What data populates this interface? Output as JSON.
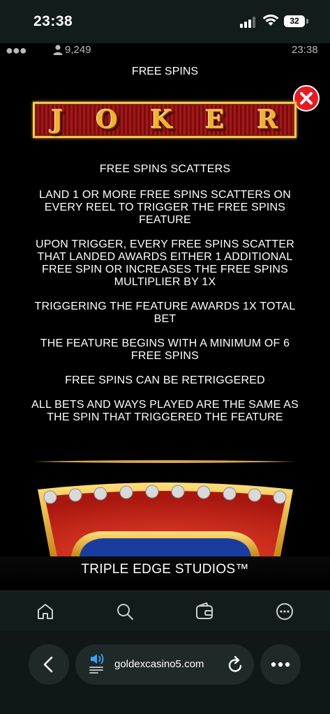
{
  "status_bar": {
    "time": "23:38",
    "battery": "32"
  },
  "game_bar": {
    "player_count": "9,249",
    "time": "23:38"
  },
  "screen": {
    "title": "FREE SPINS",
    "logo_text": "JOKER",
    "subtitle": "FREE SPINS SCATTERS",
    "rules": [
      "LAND 1 OR MORE FREE SPINS SCATTERS ON EVERY REEL TO TRIGGER THE FREE SPINS FEATURE",
      "UPON TRIGGER, EVERY FREE SPINS SCATTER THAT LANDED AWARDS EITHER 1 ADDITIONAL FREE SPIN OR INCREASES THE FREE SPINS MULTIPLIER BY 1X",
      "TRIGGERING THE FEATURE AWARDS 1X TOTAL BET",
      "THE FEATURE BEGINS WITH A MINIMUM OF 6 FREE SPINS",
      "FREE SPINS CAN BE RETRIGGERED",
      "ALL BETS AND WAYS PLAYED ARE THE SAME AS THE SPIN THAT TRIGGERED THE FEATURE"
    ],
    "studio": "TRIPLE EDGE STUDIOS™"
  },
  "browser": {
    "url": "goldexcasino5.com",
    "toolbar_icons": [
      "home-icon",
      "search-icon",
      "wallet-icon",
      "more-icon"
    ]
  },
  "colors": {
    "close_red": "#e31b23",
    "logo_gold": "#f1b232",
    "logo_red": "#a3181a",
    "toolbar_bg": "#121c1a"
  }
}
